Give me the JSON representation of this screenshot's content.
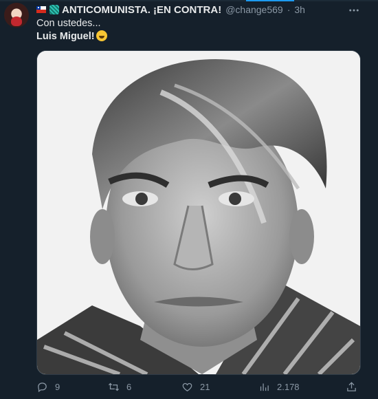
{
  "tweet": {
    "display_name": "ANTICOMUNISTA. ¡EN CONTRA!",
    "handle": "@change569",
    "separator": "·",
    "time": "3h",
    "more_icon": "more-icon",
    "text_line1": "Con ustedes...",
    "text_line2": "Luis Miguel!",
    "emoji": "grinning-face-emoji",
    "badges": [
      "chile-flag-icon",
      "verified-badge-icon"
    ],
    "media": {
      "type": "photo",
      "subject": "black-and-white portrait"
    }
  },
  "actions": {
    "replies": "9",
    "retweets": "6",
    "likes": "21",
    "views": "2.178",
    "icons": [
      "reply-icon",
      "retweet-icon",
      "like-icon",
      "views-icon",
      "share-icon"
    ]
  },
  "colors": {
    "background": "#15202b",
    "text": "#e7e9ea",
    "secondary": "#8b98a5",
    "accent": "#1d9bf0"
  }
}
